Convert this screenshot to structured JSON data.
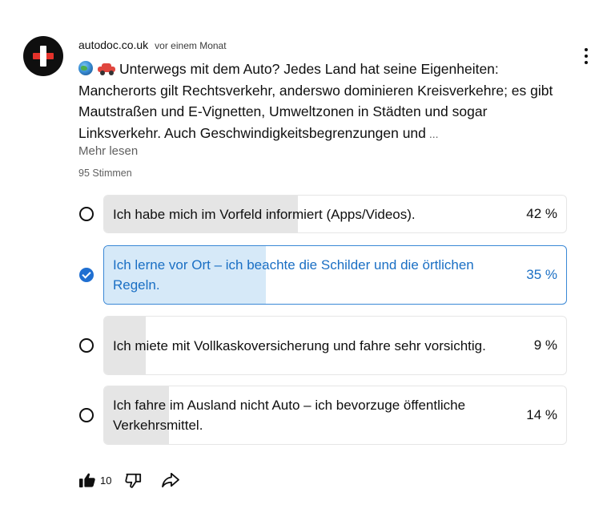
{
  "post": {
    "channel": "autodoc.co.uk",
    "time": "vor einem Monat",
    "text": "Unterwegs mit dem Auto? Jedes Land hat seine Eigenheiten: Mancherorts gilt Rechtsverkehr, anderswo dominieren Kreisverkehre; es gibt Mautstraßen und E-Vignetten, Umweltzonen in Städten und sogar Linksverkehr. Auch Geschwindigkeitsbegrenzungen und",
    "ellipsis": "...",
    "more_label": "Mehr lesen",
    "emojis": [
      "globe-emoji",
      "car-emoji"
    ]
  },
  "poll": {
    "votes_label": "95 Stimmen",
    "options": [
      {
        "label": "Ich habe mich im Vorfeld informiert (Apps/Videos).",
        "percent_label": "42 %",
        "percent": 42,
        "selected": false
      },
      {
        "label": "Ich lerne vor Ort – ich beachte die Schilder und die örtlichen Regeln.",
        "percent_label": "35 %",
        "percent": 35,
        "selected": true
      },
      {
        "label": "Ich miete mit Vollkaskoversicherung und fahre sehr vorsichtig.",
        "percent_label": "9 %",
        "percent": 9,
        "selected": false
      },
      {
        "label": "Ich fahre im Ausland nicht Auto – ich bevorzuge öffentliche Verkehrsmittel.",
        "percent_label": "14 %",
        "percent": 14,
        "selected": false
      }
    ]
  },
  "actions": {
    "like_count": "10",
    "like_active": true,
    "icons": [
      "thumbs-up-icon",
      "thumbs-down-icon",
      "share-icon"
    ]
  },
  "colors": {
    "selected_accent": "#1f6fd1",
    "selected_fill": "#d6e9f8",
    "bar_fill": "#e5e5e5",
    "brand_red": "#e4322b"
  }
}
